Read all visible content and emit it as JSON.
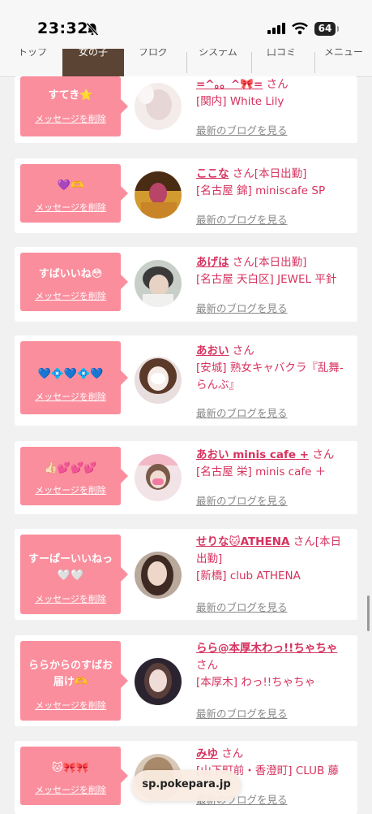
{
  "status_bar": {
    "time": "23:32",
    "battery": "64"
  },
  "nav": {
    "tabs": [
      "トップ",
      "女の子",
      "ブログ",
      "システム",
      "口コミ",
      "メニュー"
    ],
    "active_index": 1
  },
  "messages": [
    {
      "text_lines": [
        "すてき⭐"
      ],
      "delete_label": "メッセージを削除",
      "name": "=^。。^🎀=",
      "san": "さん",
      "shop": "[関内] White Lily",
      "blog": "最新のブログを見る"
    },
    {
      "text_lines": [
        "💜🫶"
      ],
      "delete_label": "メッセージを削除",
      "name": "ここな",
      "san": "さん[本日出勤]",
      "shop": "[名古屋 錦] miniscafe SP",
      "blog": "最新のブログを見る"
    },
    {
      "text_lines": [
        "すばいいね😳"
      ],
      "delete_label": "メッセージを削除",
      "name": "あげは",
      "san": "さん[本日出勤]",
      "shop": "[名古屋 天白区] JEWEL 平針",
      "blog": "最新のブログを見る"
    },
    {
      "text_lines": [
        "💙💠💙💠💙"
      ],
      "delete_label": "メッセージを削除",
      "name": "あおい",
      "san": "さん",
      "shop": "[安城] 熟女キャバクラ『乱舞-らんぶ』",
      "blog": "最新のブログを見る"
    },
    {
      "text_lines": [
        "👍🏻💕💕💕"
      ],
      "delete_label": "メッセージを削除",
      "name": "あおい minis cafe +",
      "san": "さん",
      "shop": "[名古屋 栄] minis cafe ＋",
      "blog": "最新のブログを見る"
    },
    {
      "text_lines": [
        "すーぱーいいねっ",
        "🤍🤍"
      ],
      "delete_label": "メッセージを削除",
      "name": "せりな🐱ATHENA",
      "san": "さん[本日出勤]",
      "shop": "[新橋] club ATHENA",
      "blog": "最新のブログを見る"
    },
    {
      "text_lines": [
        "ららからのすばお",
        "届け🫶"
      ],
      "delete_label": "メッセージを削除",
      "name": "らら@本厚木わっ!!ちゃちゃ",
      "san": "さん",
      "shop": "[本厚木] わっ!!ちゃちゃ",
      "blog": "最新のブログを見る"
    },
    {
      "text_lines": [
        "🐱🎀🎀"
      ],
      "delete_label": "メッセージを削除",
      "name": "みゆ",
      "san": "さん",
      "shop": "[山下町前・香澄町] CLUB 藤",
      "blog": "最新のブログを見る"
    }
  ],
  "url_bar": {
    "domain": "sp.pokepara.jp"
  }
}
